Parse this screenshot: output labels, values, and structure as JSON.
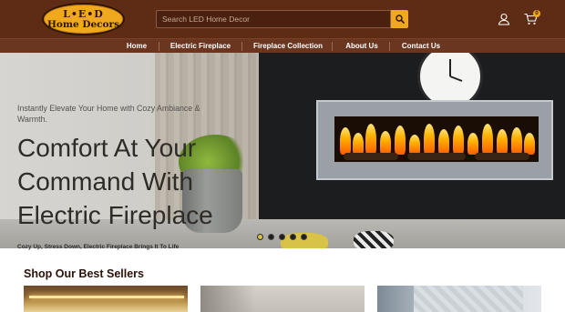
{
  "header": {
    "logo_line1": "L•E•D",
    "logo_line2": "Home Decors",
    "search_placeholder": "Search LED Home Decor",
    "cart_count": "0",
    "icons": {
      "search": "search-icon",
      "user": "user-icon",
      "cart": "cart-icon"
    }
  },
  "nav": {
    "items": [
      {
        "label": "Home"
      },
      {
        "label": "Electric Fireplace"
      },
      {
        "label": "Fireplace Collection"
      },
      {
        "label": "About Us"
      },
      {
        "label": "Contact Us"
      }
    ]
  },
  "hero": {
    "kicker": "Instantly Elevate Your Home with Cozy Ambiance & Warmth.",
    "title": "Comfort At Your Command With Electric Fireplace",
    "subtitle": "Cozy Up, Stress Down, Electric Fireplace Brings It To Life",
    "slide_count": 5,
    "active_slide": 1
  },
  "best_sellers": {
    "title": "Shop Our Best Sellers"
  },
  "colors": {
    "header_bg": "#5e2c15",
    "nav_bg": "#6b3620",
    "accent": "#f0a81e",
    "dot_active": "#d8c248"
  }
}
